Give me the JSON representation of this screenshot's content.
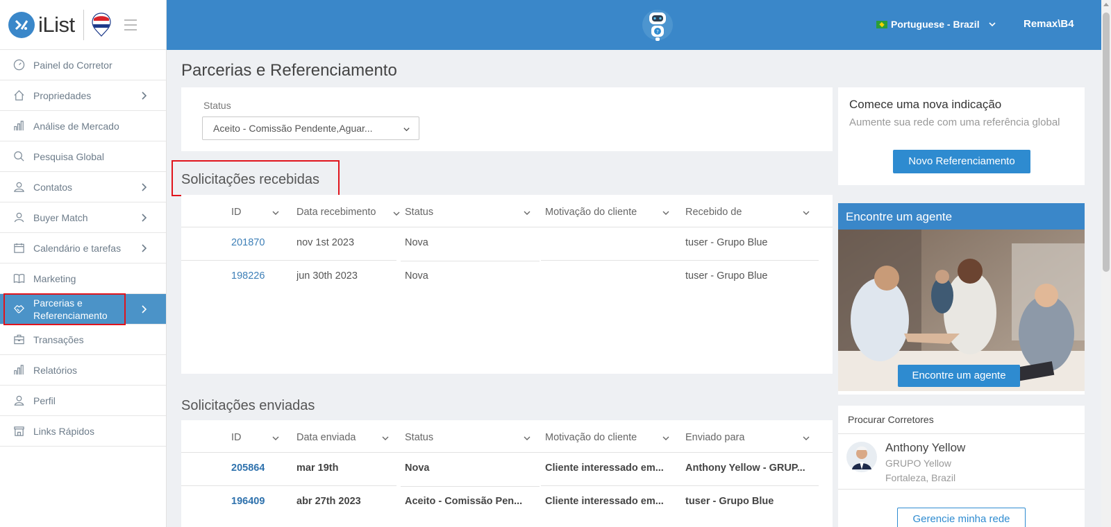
{
  "app": {
    "name": "iList"
  },
  "sidebar": {
    "items": [
      {
        "label": "Painel do Corretor",
        "icon": "gauge-icon",
        "has_children": false
      },
      {
        "label": "Propriedades",
        "icon": "house-icon",
        "has_children": true
      },
      {
        "label": "Análise de Mercado",
        "icon": "bar-chart-icon",
        "has_children": false
      },
      {
        "label": "Pesquisa Global",
        "icon": "search-icon",
        "has_children": false
      },
      {
        "label": "Contatos",
        "icon": "contacts-icon",
        "has_children": true
      },
      {
        "label": "Buyer Match",
        "icon": "user-icon",
        "has_children": true
      },
      {
        "label": "Calendário e tarefas",
        "icon": "calendar-icon",
        "has_children": true
      },
      {
        "label": "Marketing",
        "icon": "book-icon",
        "has_children": false
      },
      {
        "label_line1": "Parcerias e",
        "label_line2": "Referenciamento",
        "icon": "handshake-icon",
        "has_children": true,
        "active": true
      },
      {
        "label": "Transações",
        "icon": "briefcase-icon",
        "has_children": false
      },
      {
        "label": "Relatórios",
        "icon": "bar-chart-icon",
        "has_children": false
      },
      {
        "label": "Perfil",
        "icon": "user-icon",
        "has_children": false
      },
      {
        "label": "Links Rápidos",
        "icon": "store-icon",
        "has_children": false
      }
    ]
  },
  "header": {
    "language": "Portuguese - Brazil",
    "user": "Remax\\B4",
    "assistant_icon": "robot-help-icon"
  },
  "main": {
    "title": "Parcerias e Referenciamento",
    "filter": {
      "label": "Status",
      "value": "Aceito - Comissão Pendente,Aguar..."
    },
    "received": {
      "title": "Solicitações recebidas",
      "columns": [
        "ID",
        "Data recebimento",
        "Status",
        "Motivação do cliente",
        "Recebido de"
      ],
      "rows": [
        [
          "201870",
          "nov 1st 2023",
          "Nova",
          "",
          "tuser - Grupo Blue"
        ],
        [
          "198226",
          "jun 30th 2023",
          "Nova",
          "",
          "tuser - Grupo Blue"
        ]
      ]
    },
    "sent": {
      "title": "Solicitações enviadas",
      "columns": [
        "ID",
        "Data enviada",
        "Status",
        "Motivação do cliente",
        "Enviado para"
      ],
      "rows": [
        [
          "205864",
          "mar 19th",
          "Nova",
          "Cliente interessado em...",
          "Anthony Yellow - GRUP..."
        ],
        [
          "196409",
          "abr 27th 2023",
          "Aceito - Comissão Pen...",
          "Cliente interessado em...",
          "tuser - Grupo Blue"
        ]
      ]
    }
  },
  "right": {
    "promo": {
      "title": "Comece uma nova indicação",
      "subtitle": "Aumente sua rede com uma referência global",
      "button": "Novo Referenciamento"
    },
    "agent": {
      "title": "Encontre um agente",
      "button": "Encontre um agente"
    },
    "brokers": {
      "title": "Procurar Corretores",
      "name": "Anthony Yellow",
      "group": "GRUPO Yellow",
      "location": "Fortaleza, Brazil",
      "button": "Gerencie minha rede"
    }
  },
  "colors": {
    "primary": "#3a87c9",
    "button": "#2e8bd0",
    "highlight": "#e0141c",
    "link": "#3d7fb7"
  }
}
